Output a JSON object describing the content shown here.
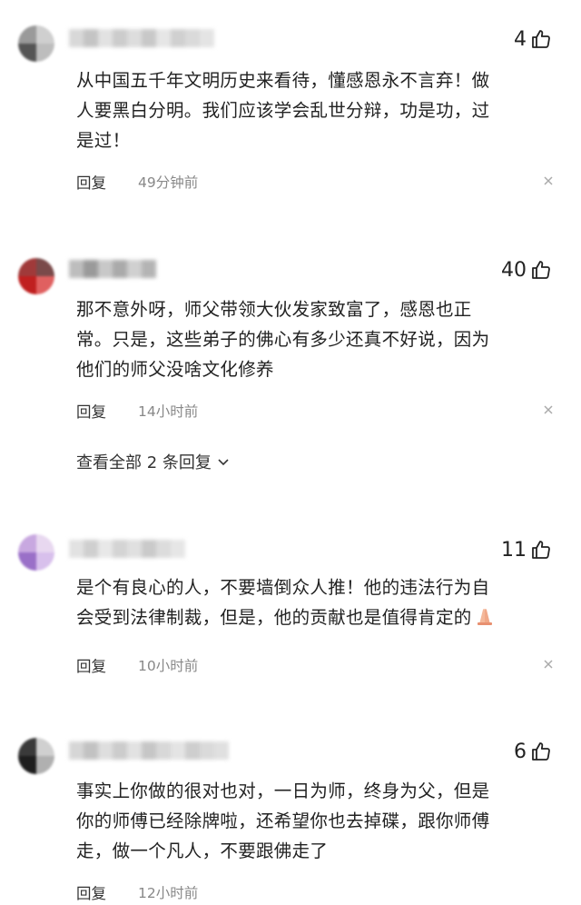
{
  "comments": [
    {
      "likes": "4",
      "text_lines": [
        "从中国五千年文明历史来看待，懂感恩永不言弃！做",
        "人要黑白分明。我们应该学会乱世分辩，功是功，过",
        "是过！"
      ],
      "reply_label": "回复",
      "time": "49分钟前"
    },
    {
      "likes": "40",
      "text_lines": [
        "那不意外呀，师父带领大伙发家致富了，感恩也正",
        "常。只是，这些弟子的佛心有多少还真不好说，因为",
        "他们的师父没啥文化修养"
      ],
      "reply_label": "回复",
      "time": "14小时前",
      "view_replies": "查看全部 2 条回复"
    },
    {
      "likes": "11",
      "text_lines": [
        "是个有良心的人，不要墙倒众人推！他的违法行为自",
        "会受到法律制裁，但是，他的贡献也是值得肯定的"
      ],
      "reply_label": "回复",
      "time": "10小时前"
    },
    {
      "likes": "6",
      "text_lines": [
        "事实上你做的很对也对，一日为师，终身为父，但是",
        "你的师傅已经除牌啦，还希望你也去掉碟，跟你师傅",
        "走，做一个凡人，不要跟佛走了"
      ],
      "reply_label": "回复",
      "time": "12小时前"
    }
  ],
  "colors": {
    "text": "#222222",
    "muted": "#888888",
    "avatar1": [
      "#9a9a9a",
      "#cfcfcf",
      "#555555",
      "#bdbdbd"
    ],
    "avatar2": [
      "#a03a3a",
      "#7a4a4a",
      "#c02020",
      "#e06060"
    ],
    "avatar3": [
      "#c8a8e0",
      "#e8d8f0",
      "#9a70c8",
      "#d8c0ec"
    ],
    "avatar4": [
      "#3a3a3a",
      "#d0d0d0",
      "#1e1e1e",
      "#b0b0b0"
    ]
  },
  "icons": [
    "like-thumb-icon",
    "close-icon",
    "chevron-down-icon",
    "praying-hands-emoji"
  ]
}
